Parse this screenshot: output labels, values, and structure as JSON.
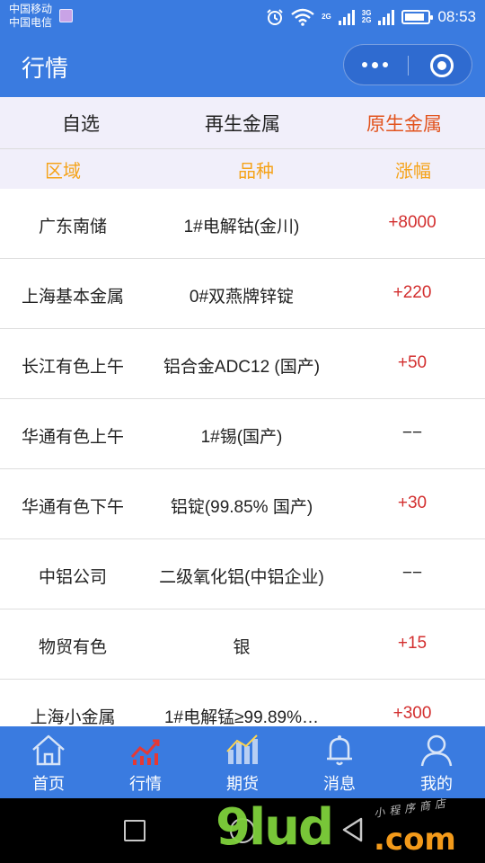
{
  "status_bar": {
    "carrier1": "中国移动",
    "carrier2": "中国电信",
    "net1": "2G",
    "net2a": "3G",
    "net2b": "2G",
    "time": "08:53",
    "battery_level": 0.85
  },
  "header": {
    "title": "行情"
  },
  "tabs": [
    {
      "label": "自选",
      "active": false
    },
    {
      "label": "再生金属",
      "active": false
    },
    {
      "label": "原生金属",
      "active": true
    }
  ],
  "columns": {
    "region": "区域",
    "variety": "品种",
    "change": "涨幅"
  },
  "rows": [
    {
      "region": "广东南储",
      "variety": "1#电解钴(金川)",
      "change": "+8000"
    },
    {
      "region": "上海基本金属",
      "variety": "0#双燕牌锌锭",
      "change": "+220"
    },
    {
      "region": "长江有色上午",
      "variety": "铝合金ADC12 (国产)",
      "change": "+50"
    },
    {
      "region": "华通有色上午",
      "variety": "1#锡(国产)",
      "change": "−−"
    },
    {
      "region": "华通有色下午",
      "variety": "铝锭(99.85% 国产)",
      "change": "+30"
    },
    {
      "region": "中铝公司",
      "variety": "二级氧化铝(中铝企业)",
      "change": "−−"
    },
    {
      "region": "物贸有色",
      "variety": "银",
      "change": "+15"
    },
    {
      "region": "上海小金属",
      "variety": "1#电解锰≥99.89%…",
      "change": "+300"
    }
  ],
  "bottom_nav": [
    {
      "label": "首页",
      "icon": "home-icon"
    },
    {
      "label": "行情",
      "icon": "market-trend-icon",
      "active": true
    },
    {
      "label": "期货",
      "icon": "futures-chart-icon"
    },
    {
      "label": "消息",
      "icon": "bell-icon"
    },
    {
      "label": "我的",
      "icon": "user-icon"
    }
  ],
  "watermark": {
    "main": "9lud",
    "com": ".com",
    "small": "小程序商店"
  },
  "colors": {
    "primary": "#3a7be0",
    "active_tab": "#e2541f",
    "column_header": "#f5a31a",
    "positive": "#d32f2f"
  }
}
